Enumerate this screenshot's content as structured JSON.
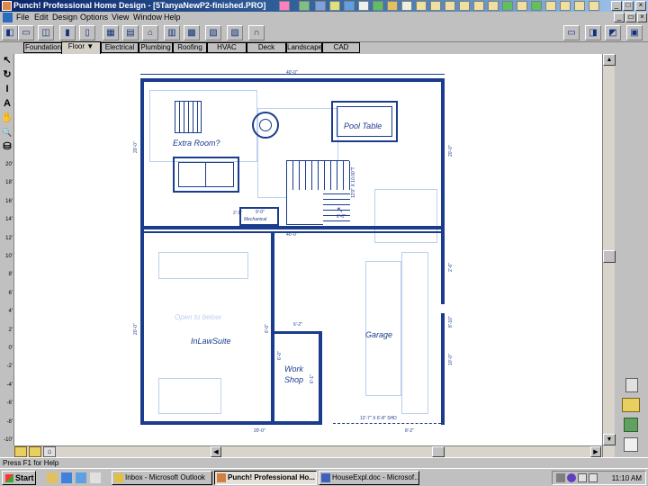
{
  "window": {
    "title": "Punch! Professional Home Design - [5TanyaNewP2-finished.PRO]",
    "minimize": "_",
    "maximize": "□",
    "close": "×"
  },
  "menu": [
    "File",
    "Edit",
    "Design",
    "Options",
    "View",
    "Window",
    "Help"
  ],
  "tabs": [
    {
      "label": "Foundation",
      "active": false
    },
    {
      "label": "Floor",
      "active": true
    },
    {
      "label": "Electrical",
      "active": false
    },
    {
      "label": "Plumbing",
      "active": false
    },
    {
      "label": "Roofing",
      "active": false
    },
    {
      "label": "HVAC",
      "active": false
    },
    {
      "label": "Deck",
      "active": false
    },
    {
      "label": "Landscape",
      "active": false
    },
    {
      "label": "CAD",
      "active": false
    }
  ],
  "floor_tab_arrow": "▼",
  "left_tools": [
    "pointer-icon",
    "rotate-icon",
    "dimension-icon",
    "text-icon",
    "pan-hand-icon",
    "zoom-icon",
    "walkthrough-icon"
  ],
  "left_tool_glyphs": [
    "↖",
    "↻",
    "I",
    "A",
    "✋",
    "🔍",
    "⛁"
  ],
  "ruler_labels": [
    "20'",
    "18'",
    "16'",
    "14'",
    "12'",
    "10'",
    "8'",
    "6'",
    "4'",
    "2'",
    "0'",
    "-2'",
    "-4'",
    "-6'",
    "-8'",
    "-10'"
  ],
  "plan": {
    "rooms": {
      "extra_room": "Extra Room?",
      "pool_table": "Pool Table",
      "inlaw_suite": "InLawSuite",
      "garage": "Garage",
      "work_shop": "Work\nShop",
      "mechanical": "Mechanical",
      "open_to_below": "Open to below"
    },
    "dimensions": {
      "top_width": "40'-0\"",
      "mid_width": "40'-0\"",
      "left_upper": "20'-0\"",
      "right_upper": "20'-0\"",
      "mech_w": "9'-0\"",
      "mech_h": "2'-1\"",
      "stair": "12'0\" X 10.00\"T",
      "stair_v": "6'-0\"",
      "workshop_w": "6'-2\"",
      "workshop_h": "6'-1\"",
      "inlaw_h": "20'-0\"",
      "garage_right": "8'-10\"",
      "garage_right_upper": "2'-6\"",
      "garage_door": "12'-7\" X 6'-8\" SHD",
      "bottom_left": "20'-0\"",
      "bottom_right": "8'-2\"",
      "inlaw_right_h": "6'-0\"",
      "workshop_side": "6'-0\"",
      "garage_right_lower": "10'-0\""
    }
  },
  "status": "Press F1 for Help",
  "taskbar": {
    "start": "Start",
    "tasks": [
      {
        "label": "Inbox - Microsoft Outlook",
        "active": false
      },
      {
        "label": "Punch! Professional Ho...",
        "active": true
      },
      {
        "label": "HouseExpl.doc - Microsof...",
        "active": false
      }
    ],
    "clock": "11:10 AM"
  },
  "colors": {
    "plan_blue": "#1a3c8c",
    "faint_blue": "#bcd0ec",
    "title_blue": "#0a246a"
  }
}
